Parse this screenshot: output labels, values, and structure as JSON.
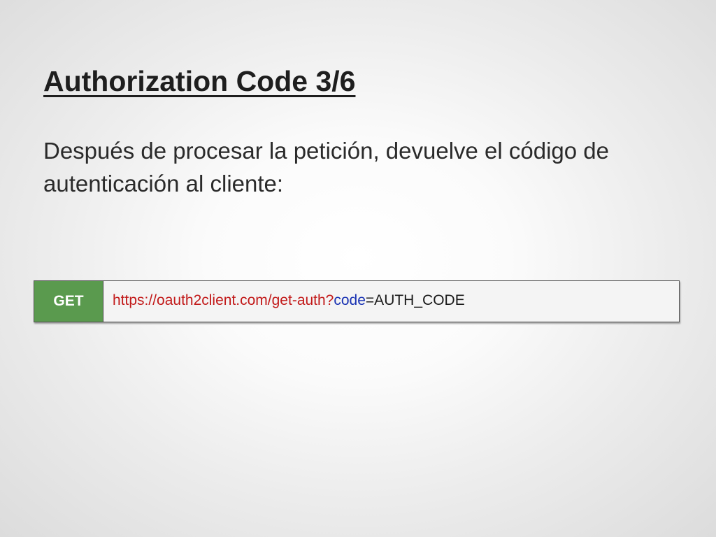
{
  "slide": {
    "title": "Authorization Code 3/6",
    "body": "Después de procesar la petición, devuelve el código de autenticación al cliente:"
  },
  "request": {
    "method": "GET",
    "url_base": "https://oauth2client.com/get-auth?",
    "param_name": "code",
    "param_value": "=AUTH_CODE"
  },
  "colors": {
    "method_bg": "#5a9a4e",
    "url_base": "#c21a1a",
    "param_name": "#1a33b3",
    "param_value": "#1a1a1a"
  }
}
